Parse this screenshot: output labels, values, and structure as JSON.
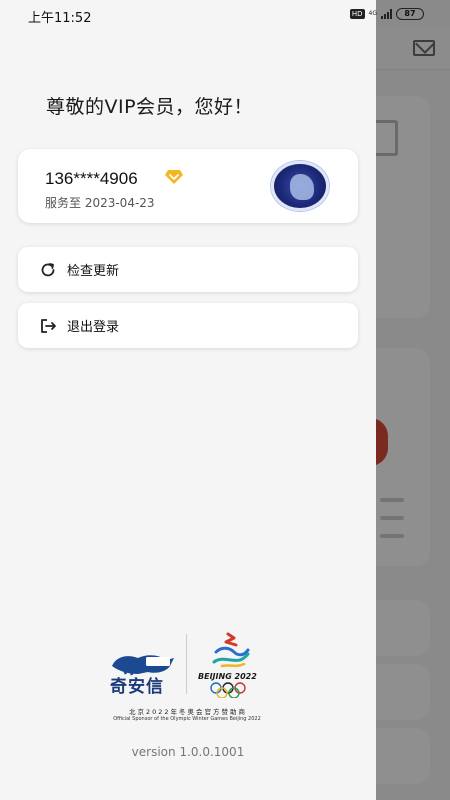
{
  "status_bar": {
    "time": "上午11:52",
    "hd": "HD",
    "network": "4G",
    "battery": "87"
  },
  "drawer": {
    "greeting": "尊敬的VIP会员，您好！",
    "user": {
      "phone": "136****4906",
      "service_until": "服务至 2023-04-23"
    },
    "menu": {
      "check_update": "检查更新",
      "logout": "退出登录"
    },
    "sponsor": {
      "brand": "奇安信",
      "event_text": "BEIJING 2022",
      "cn_line": "北京2022年冬奥会官方赞助商",
      "en_line": "Official Sponsor of the Olympic Winter Games Beijing 2022"
    },
    "version": "version 1.0.0.1001"
  },
  "colors": {
    "accent_gold": "#f5b622",
    "drawer_bg": "#f5f5f5",
    "overlay": "#8a8a8a",
    "brand_blue": "#1b3a7a"
  },
  "icons": {
    "vip": "diamond-chevron-icon",
    "update": "refresh-icon",
    "logout": "logout-icon",
    "mail": "mail-icon"
  }
}
